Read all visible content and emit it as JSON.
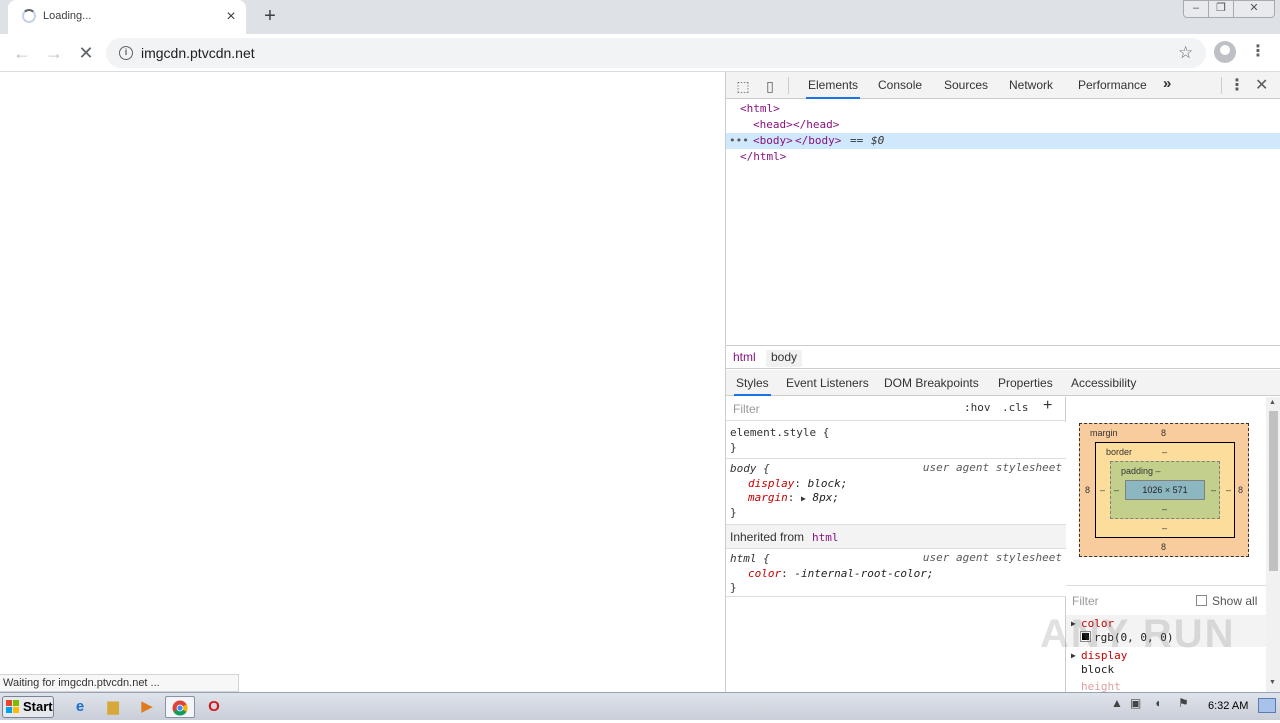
{
  "browser": {
    "tab_title": "Loading...",
    "url": "imgcdn.ptvcdn.net",
    "status_text": "Waiting for imgcdn.ptvcdn.net ..."
  },
  "devtools": {
    "tabs": [
      "Elements",
      "Console",
      "Sources",
      "Network",
      "Performance"
    ],
    "more_tabs": "»",
    "dom": {
      "line1": "<html>",
      "line2_open": "<head>",
      "line2_close": "</head>",
      "line3_ellipsis": "•••",
      "line3_open": "<body>",
      "line3_close": "</body>",
      "line3_eq": "==",
      "line3_ref": "$0",
      "line4": "</html>"
    },
    "breadcrumbs": [
      "html",
      "body"
    ],
    "sub_tabs": [
      "Styles",
      "Event Listeners",
      "DOM Breakpoints",
      "Properties",
      "Accessibility"
    ],
    "styles": {
      "filter_placeholder": "Filter",
      "hov": ":hov",
      "cls": ".cls",
      "plus": "+",
      "element_style_open": "element.style {",
      "close_brace": "}",
      "body_selector": "body",
      "open_brace": "{",
      "source": "user agent stylesheet",
      "body_prop1_name": "display",
      "body_prop1_value": "block;",
      "body_prop2_name": "margin",
      "body_prop2_value": "8px;",
      "inherited_label": "Inherited from",
      "inherited_from": "html",
      "html_selector": "html",
      "html_prop1_name": "color",
      "html_prop1_value": "-internal-root-color;"
    },
    "box_model": {
      "margin_label": "margin",
      "margin_top": "8",
      "margin_bottom": "8",
      "margin_left": "8",
      "margin_right": "8",
      "border_label": "border",
      "border_top": "–",
      "border_bottom": "–",
      "border_left": "–",
      "border_right": "–",
      "padding_label": "padding –",
      "padding_bottom": "–",
      "padding_left": "–",
      "padding_right": "–",
      "content_size": "1026 × 571"
    },
    "computed": {
      "filter_placeholder": "Filter",
      "show_all": "Show all",
      "props": [
        {
          "name": "color",
          "value": "rgb(0, 0, 0)"
        },
        {
          "name": "display",
          "value": "block"
        },
        {
          "name": "height",
          "value": ""
        }
      ]
    }
  },
  "taskbar": {
    "start_label": "Start",
    "clock": "6:32 AM"
  },
  "watermark": "ANY RUN"
}
